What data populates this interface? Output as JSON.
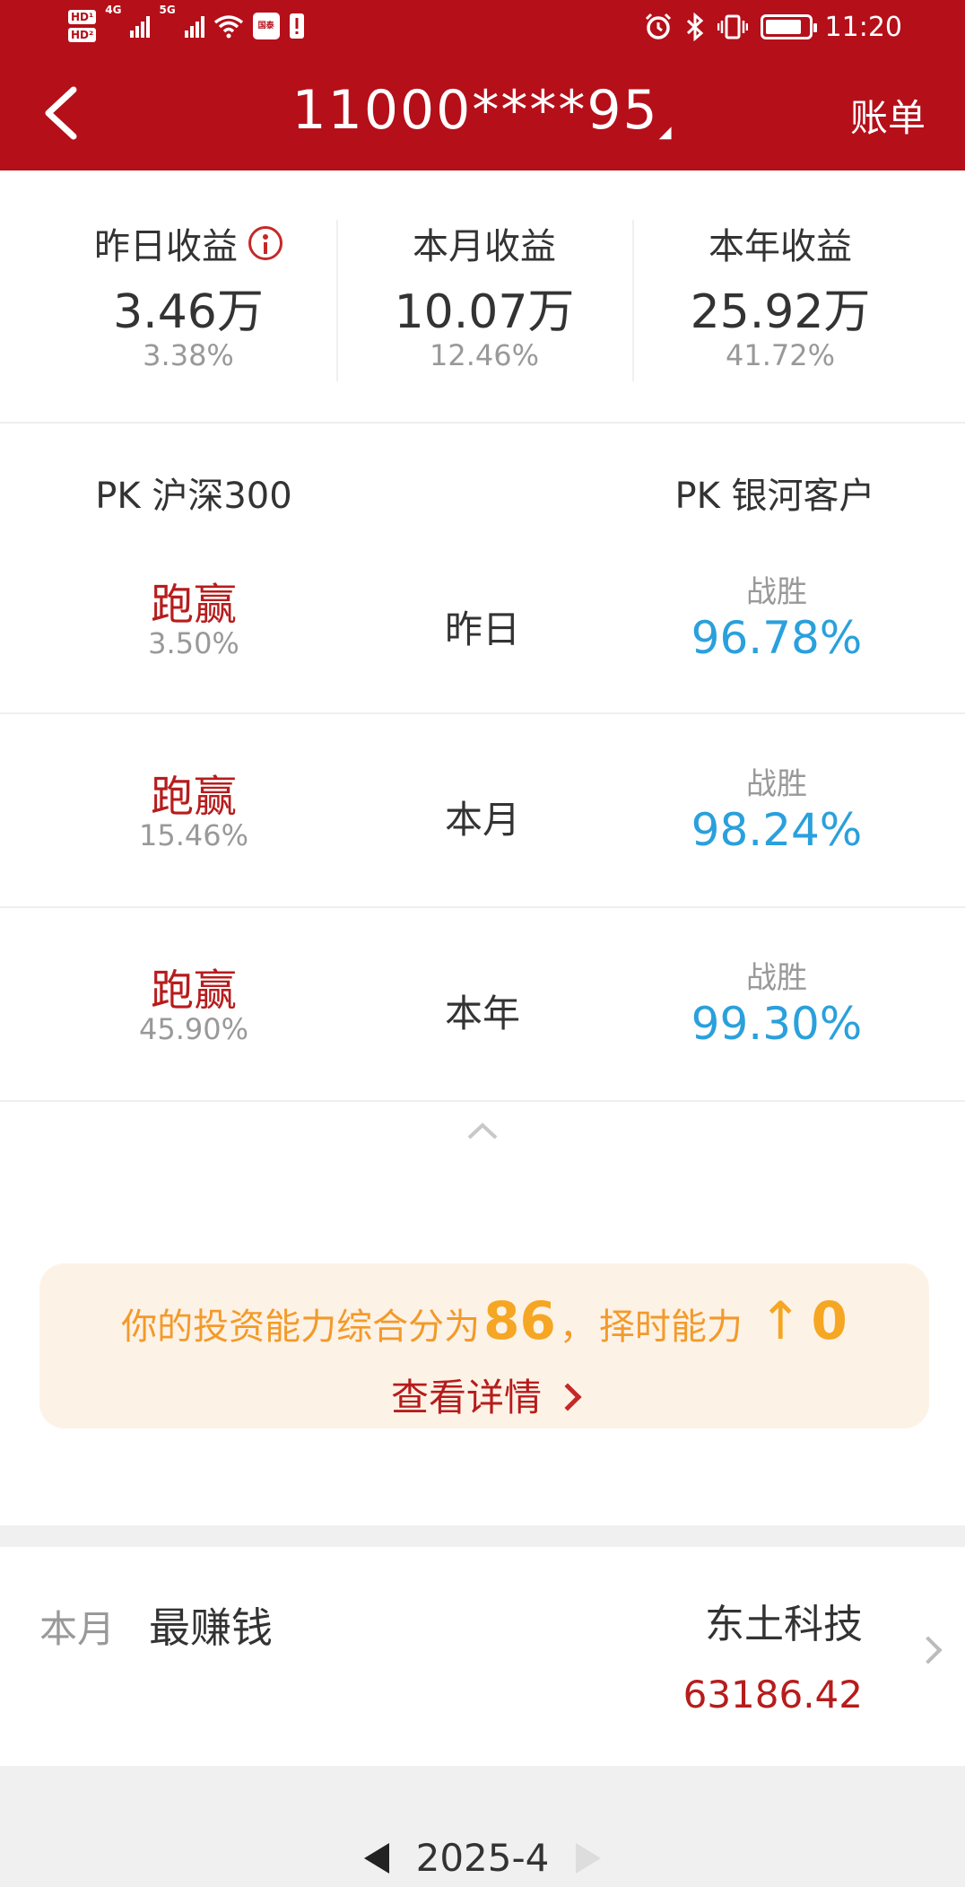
{
  "status_bar": {
    "net1": "4G",
    "net2": "5G",
    "app_badge": "国泰",
    "time": "11:20",
    "battery_level": 0.85
  },
  "nav": {
    "title": "11000****95",
    "right_label": "账单"
  },
  "summary": [
    {
      "label": "昨日收益",
      "value": "3.46万",
      "pct": "3.38%"
    },
    {
      "label": "本月收益",
      "value": "10.07万",
      "pct": "12.46%"
    },
    {
      "label": "本年收益",
      "value": "25.92万",
      "pct": "41.72%"
    }
  ],
  "pk": {
    "left_header": "PK 沪深300",
    "right_header": "PK 银河客户",
    "rows": [
      {
        "result": "跑赢",
        "diff": "3.50%",
        "period": "昨日",
        "beat_label": "战胜",
        "beat_pct": "96.78%"
      },
      {
        "result": "跑赢",
        "diff": "15.46%",
        "period": "本月",
        "beat_label": "战胜",
        "beat_pct": "98.24%"
      },
      {
        "result": "跑赢",
        "diff": "45.90%",
        "period": "本年",
        "beat_label": "战胜",
        "beat_pct": "99.30%"
      }
    ]
  },
  "banner": {
    "prefix": "你的投资能力综合分为",
    "score": "86",
    "sep": "，",
    "timing_label": "择时能力",
    "timing_arrow": "↑",
    "timing_value": "0",
    "link": "查看详情"
  },
  "best": {
    "month": "本月",
    "label": "最赚钱",
    "stock": "东土科技",
    "amount": "63186.42"
  },
  "month_nav": {
    "current": "2025-4"
  },
  "colors": {
    "brand_red": "#b50f19",
    "win_red": "#b71c1c",
    "beat_blue": "#2aa0dc",
    "banner_orange": "#f5a623"
  }
}
